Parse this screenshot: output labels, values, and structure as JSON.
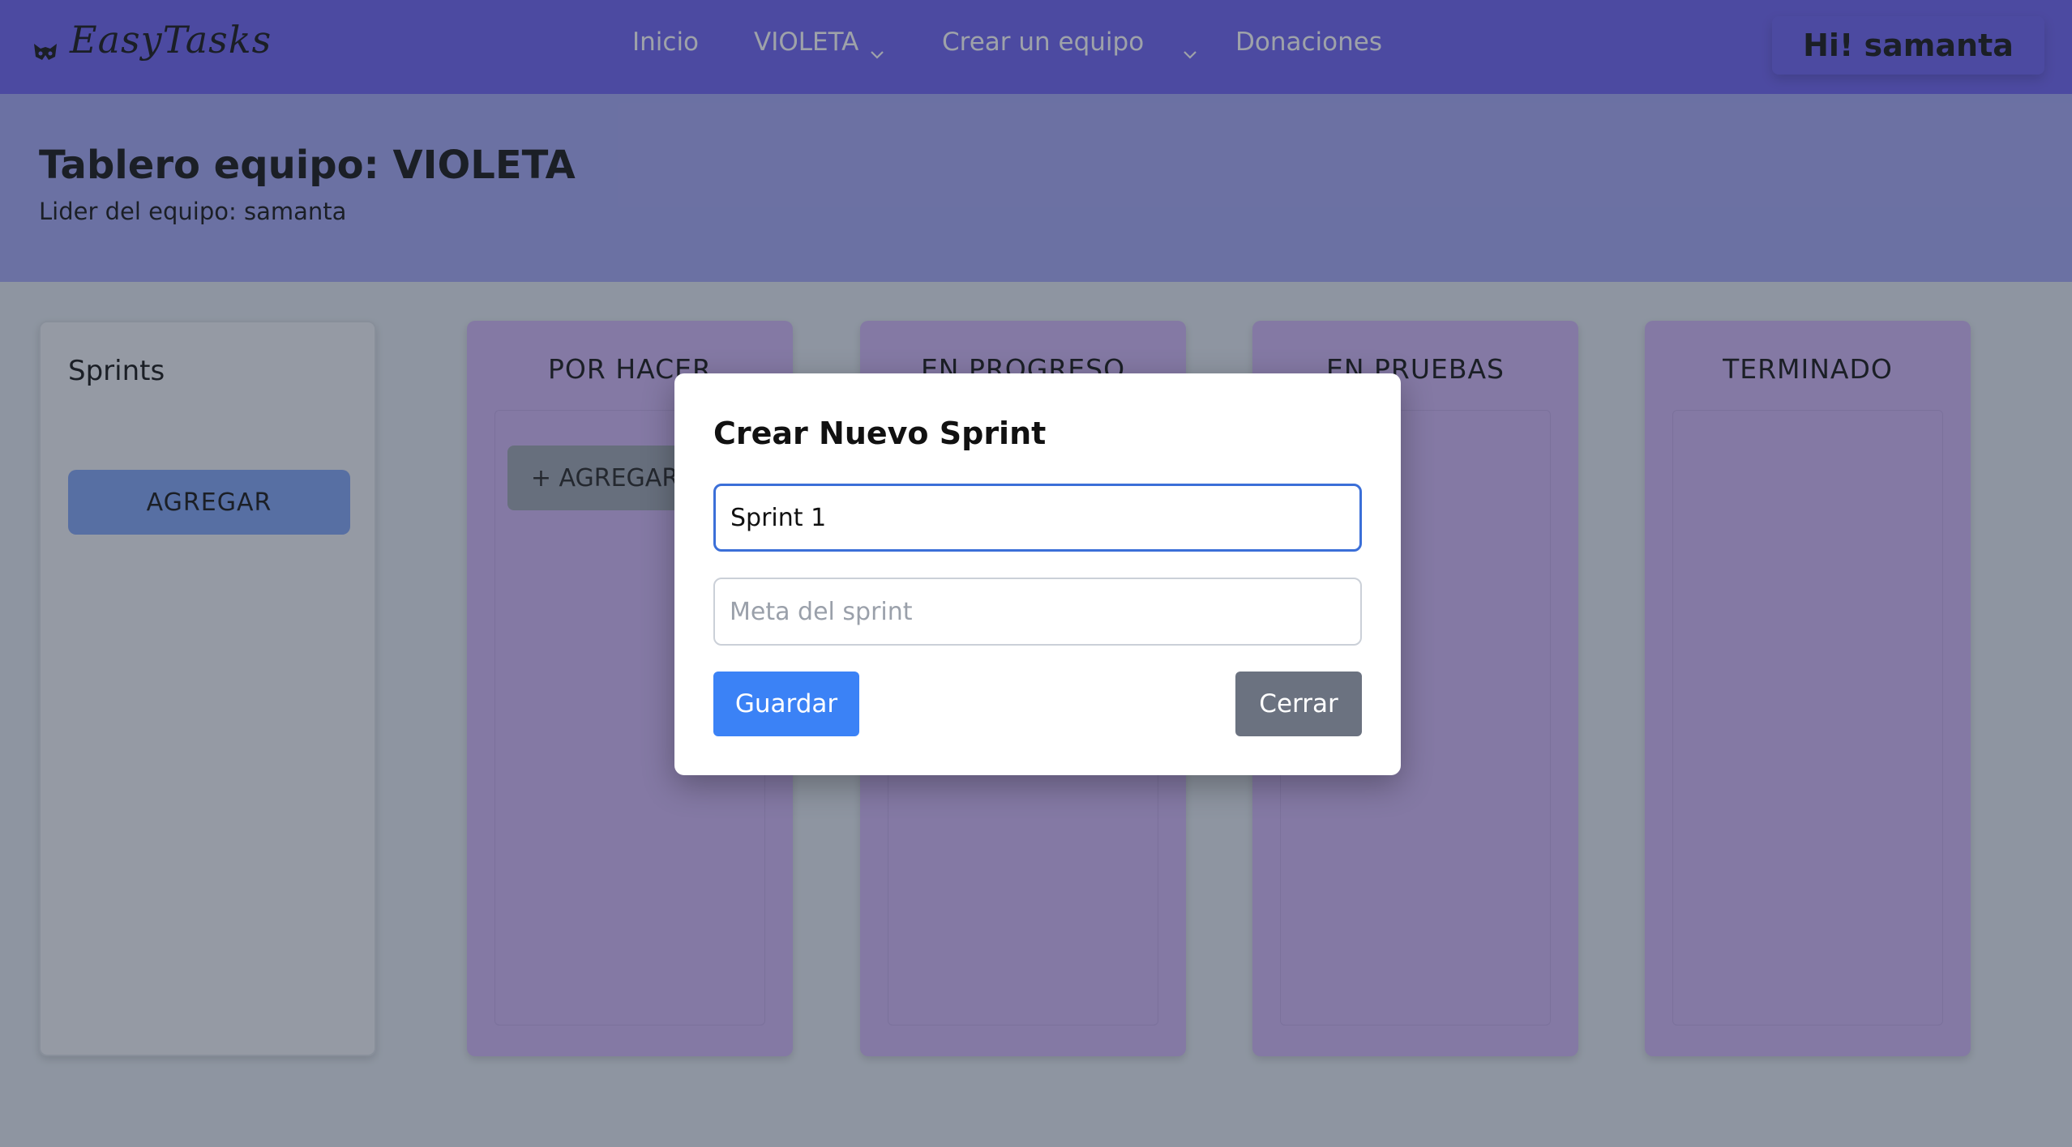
{
  "navbar": {
    "brand": "EasyTasks",
    "brand_icon": "cat-mask-icon",
    "links": {
      "home": "Inicio",
      "team": "VIOLETA",
      "create_team": "Crear un equipo",
      "donations": "Donaciones"
    },
    "greeting": "Hi! samanta"
  },
  "header": {
    "title": "Tablero equipo: VIOLETA",
    "leader": "Lider del equipo: samanta"
  },
  "sprints": {
    "title": "Sprints",
    "add_label": "AGREGAR"
  },
  "columns": [
    {
      "title": "POR HACER",
      "add_label": "+ AGREGAR"
    },
    {
      "title": "EN PROGRESO"
    },
    {
      "title": "EN PRUEBAS"
    },
    {
      "title": "TERMINADO"
    }
  ],
  "modal": {
    "title": "Crear Nuevo Sprint",
    "name_value": "Sprint 1",
    "goal_placeholder": "Meta del sprint",
    "save_label": "Guardar",
    "close_label": "Cerrar"
  },
  "colors": {
    "navbar": "#6b5ff0",
    "header_band": "#a3a7f5",
    "column_bg": "#cfb5f6",
    "save_button": "#3b82f6",
    "close_button": "#6b7280"
  }
}
